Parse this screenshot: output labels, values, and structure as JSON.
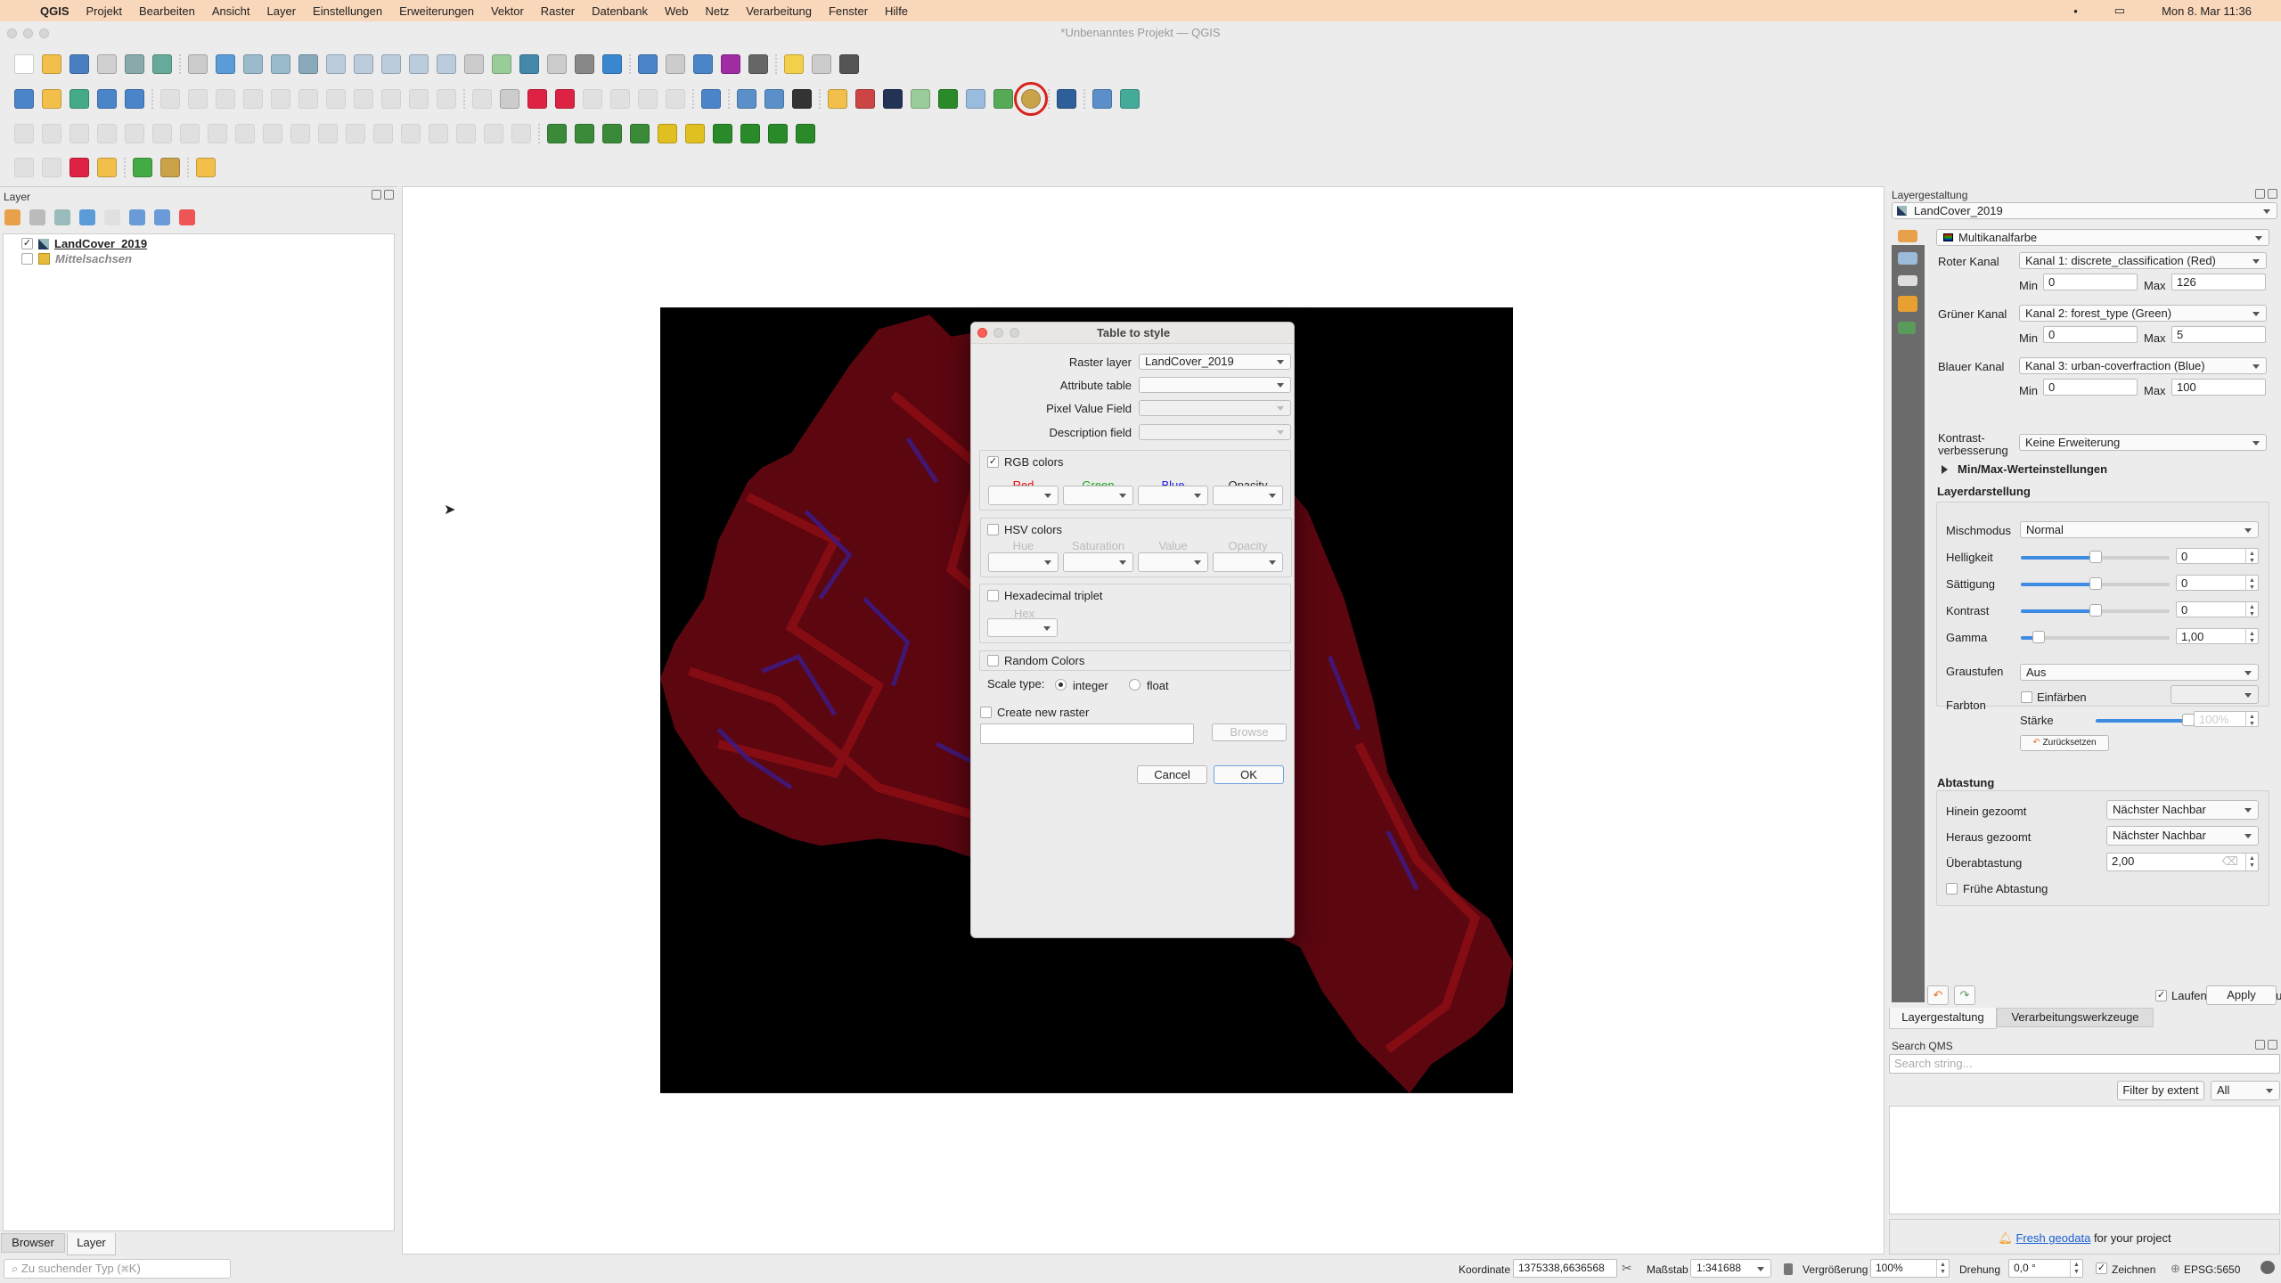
{
  "menubar": {
    "app": "QGIS",
    "items": [
      "Projekt",
      "Bearbeiten",
      "Ansicht",
      "Layer",
      "Einstellungen",
      "Erweiterungen",
      "Vektor",
      "Raster",
      "Datenbank",
      "Web",
      "Netz",
      "Verarbeitung",
      "Fenster",
      "Hilfe"
    ],
    "clock": "Mon 8. Mar  11:36"
  },
  "window": {
    "title": "*Unbenanntes Projekt — QGIS"
  },
  "toolbars": [
    [
      [
        "new-project",
        "#fff"
      ],
      [
        "open-project",
        "#f2c04a"
      ],
      [
        "save-project",
        "#4a7fc1"
      ],
      [
        "save-as",
        "#d0d0d0"
      ],
      [
        "print-layout",
        "#8aa"
      ],
      [
        "style-manager",
        "#6a9"
      ],
      [
        "|"
      ],
      [
        "pan",
        "#ccc"
      ],
      [
        "pan-to-selection",
        "#5a9bd8"
      ],
      [
        "zoom-in",
        "#9bc"
      ],
      [
        "zoom-out",
        "#9bc"
      ],
      [
        "zoom-full",
        "#8ab"
      ],
      [
        "zoom-selection",
        "#bcd"
      ],
      [
        "zoom-layer",
        "#bcd"
      ],
      [
        "zoom-native",
        "#bcd"
      ],
      [
        "zoom-last",
        "#bcd"
      ],
      [
        "zoom-next",
        "#bcd"
      ],
      [
        "new-map-view",
        "#ccc"
      ],
      [
        "new-3d-view",
        "#9c9"
      ],
      [
        "bookmark-new",
        "#48a"
      ],
      [
        "bookmarks",
        "#ccc"
      ],
      [
        "temporal",
        "#888"
      ],
      [
        "refresh",
        "#3a87d0"
      ],
      [
        "|"
      ],
      [
        "identify",
        "#4a84c9"
      ],
      [
        "attribute-table",
        "#ccc"
      ],
      [
        "settings",
        "#4a84c9"
      ],
      [
        "statistics",
        "#a02ba2"
      ],
      [
        "measure",
        "#666"
      ],
      [
        "|"
      ],
      [
        "map-tips",
        "#f2d04a"
      ],
      [
        "text-annotation",
        "#ccc"
      ],
      [
        "text-tool",
        "#555"
      ]
    ],
    [
      [
        "data-source-manager",
        "#4a84c9"
      ],
      [
        "new-geopackage",
        "#f2c04a"
      ],
      [
        "new-shapefile",
        "#4a8"
      ],
      [
        "new-temp-layer",
        "#4a84c9"
      ],
      [
        "new-virtual-layer",
        "#4a84c9"
      ],
      [
        "|"
      ],
      [
        "toggle-edit",
        "#ccc",
        1
      ],
      [
        "edit-pen",
        "#ccc",
        1
      ],
      [
        "save-edits",
        "#ccc",
        1
      ],
      [
        "add-feature",
        "#ccc",
        1
      ],
      [
        "vertex-tool",
        "#ccc",
        1
      ],
      [
        "delete",
        "#ccc",
        1
      ],
      [
        "cut",
        "#ccc",
        1
      ],
      [
        "copy",
        "#ccc",
        1
      ],
      [
        "paste",
        "#ccc",
        1
      ],
      [
        "undo",
        "#ccc",
        1
      ],
      [
        "redo",
        "#ccc",
        1
      ],
      [
        "|"
      ],
      [
        "label-tool",
        "#ccc",
        1
      ],
      [
        "label-pin",
        "#ccc"
      ],
      [
        "label-highlight",
        "#d24"
      ],
      [
        "label-abc",
        "#d24"
      ],
      [
        "label-move",
        "#ccc",
        1
      ],
      [
        "label-rotate",
        "#ccc",
        1
      ],
      [
        "label-change",
        "#ccc",
        1
      ],
      [
        "label-show",
        "#ccc",
        1
      ],
      [
        "|"
      ],
      [
        "database",
        "#4a84c9"
      ],
      [
        "|"
      ],
      [
        "globe-search",
        "#5a8fc9"
      ],
      [
        "metasearch",
        "#5a8fc9"
      ],
      [
        "qms-binoculars",
        "#333"
      ],
      [
        "|"
      ],
      [
        "python-console",
        "#f2c04a"
      ],
      [
        "plugin-fire",
        "#c44"
      ],
      [
        "earth",
        "#235"
      ],
      [
        "layers-leaf",
        "#9c9"
      ],
      [
        "info-cursor",
        "#2a8a2a"
      ],
      [
        "split-view",
        "#9bd"
      ],
      [
        "butterfly",
        "#5a5"
      ],
      [
        "table-to-style",
        "#c9a24a"
      ],
      [
        "|"
      ],
      [
        "help",
        "#2f5f9a"
      ],
      [
        "|"
      ],
      [
        "topology",
        "#5a8fc9"
      ],
      [
        "table-refresh",
        "#4a9"
      ]
    ],
    [
      [
        "digitize",
        "#ccc",
        1
      ],
      [
        "digitize-2",
        "#ccc",
        1
      ],
      [
        "digitize-3",
        "#ccc",
        1
      ],
      [
        "digitize-4",
        "#ccc",
        1
      ],
      [
        "digitize-5",
        "#ccc",
        1
      ],
      [
        "digitize-6",
        "#ccc",
        1
      ],
      [
        "digitize-7",
        "#ccc",
        1
      ],
      [
        "digitize-8",
        "#ccc",
        1
      ],
      [
        "digitize-9",
        "#ccc",
        1
      ],
      [
        "digitize-10",
        "#ccc",
        1
      ],
      [
        "digitize-11",
        "#ccc",
        1
      ],
      [
        "digitize-12",
        "#ccc",
        1
      ],
      [
        "digitize-13",
        "#ccc",
        1
      ],
      [
        "digitize-14",
        "#ccc",
        1
      ],
      [
        "digitize-15",
        "#ccc",
        1
      ],
      [
        "digitize-16",
        "#ccc",
        1
      ],
      [
        "digitize-17",
        "#ccc",
        1
      ],
      [
        "digitize-18",
        "#ccc",
        1
      ],
      [
        "digitize-19",
        "#ccc",
        1
      ],
      [
        "|"
      ],
      [
        "raster-hist-1",
        "#3a8a3a"
      ],
      [
        "raster-hist-2",
        "#3a8a3a"
      ],
      [
        "raster-hist-3",
        "#3a8a3a"
      ],
      [
        "raster-hist-4",
        "#3a8a3a"
      ],
      [
        "add-star-1",
        "#e0c020"
      ],
      [
        "add-star-2",
        "#e0c020"
      ],
      [
        "add-point-1",
        "#2a8a2a"
      ],
      [
        "add-point-2",
        "#2a8a2a"
      ],
      [
        "add-v-1",
        "#2a8a2a"
      ],
      [
        "add-v-2",
        "#2a8a2a"
      ]
    ],
    [
      [
        "select-1",
        "#ccc",
        1
      ],
      [
        "select-2",
        "#ccc",
        1
      ],
      [
        "select-expr",
        "#d24"
      ],
      [
        "select-yellow",
        "#f2c04a"
      ],
      [
        "|"
      ],
      [
        "locator",
        "#4a4"
      ],
      [
        "field-calc",
        "#c9a24a"
      ],
      [
        "|"
      ],
      [
        "vector-tool",
        "#f2c04a"
      ]
    ]
  ],
  "layers_panel": {
    "title": "Layer",
    "items": [
      {
        "name": "LandCover_2019",
        "checked": true
      },
      {
        "name": "Mittelsachsen",
        "checked": false
      }
    ],
    "tabs": [
      "Browser",
      "Layer"
    ],
    "search_placeholder": "Zu suchender Typ (⌘K)"
  },
  "dialog": {
    "title": "Table to style",
    "raster_layer_label": "Raster layer",
    "raster_layer_value": "LandCover_2019",
    "attribute_table_label": "Attribute table",
    "pixel_value_label": "Pixel Value Field",
    "description_label": "Description field",
    "rgb": {
      "label": "RGB colors",
      "checked": true,
      "cols": [
        "Red",
        "Green",
        "Blue",
        "Opacity"
      ],
      "colors": [
        "#e8000b",
        "#1aa31a",
        "#1414e6",
        "#222222"
      ]
    },
    "hsv": {
      "label": "HSV colors",
      "checked": false,
      "cols": [
        "Hue",
        "Saturation",
        "Value",
        "Opacity"
      ]
    },
    "hex": {
      "label": "Hexadecimal triplet",
      "checked": false,
      "col": "Hex"
    },
    "random": {
      "label": "Random Colors",
      "checked": false
    },
    "scale_type_label": "Scale type:",
    "scale_options": [
      "integer",
      "float"
    ],
    "scale_selected": "integer",
    "create_raster_label": "Create new raster",
    "browse": "Browse",
    "cancel": "Cancel",
    "ok": "OK"
  },
  "style_panel": {
    "title": "Layergestaltung",
    "layer": "LandCover_2019",
    "renderer": "Multikanalfarbe",
    "channels": [
      {
        "label": "Roter Kanal",
        "band": "Kanal 1: discrete_classification (Red)",
        "min": "0",
        "max": "126"
      },
      {
        "label": "Grüner Kanal",
        "band": "Kanal 2: forest_type (Green)",
        "min": "0",
        "max": "5"
      },
      {
        "label": "Blauer Kanal",
        "band": "Kanal 3: urban-coverfraction (Blue)",
        "min": "0",
        "max": "100"
      }
    ],
    "min_label": "Min",
    "max_label": "Max",
    "contrast_label_1": "Kontrast-",
    "contrast_label_2": "verbesserung",
    "contrast_value": "Keine Erweiterung",
    "minmax_section": "Min/Max-Werteinstellungen",
    "rendering_section": "Layerdarstellung",
    "blend_label": "Mischmodus",
    "blend_value": "Normal",
    "sliders": [
      {
        "label": "Helligkeit",
        "value": "0",
        "fraction": 0.5
      },
      {
        "label": "Sättigung",
        "value": "0",
        "fraction": 0.5
      },
      {
        "label": "Kontrast",
        "value": "0",
        "fraction": 0.5
      },
      {
        "label": "Gamma",
        "value": "1,00",
        "fraction": 0.12
      }
    ],
    "grayscale_label": "Graustufen",
    "grayscale_value": "Aus",
    "hue_label": "Farbton",
    "colorize_label": "Einfärben",
    "strength_label": "Stärke",
    "strength_value": "100%",
    "strength_fraction": 1.0,
    "reset": "Zurücksetzen",
    "resampling_section": "Abtastung",
    "zoomed_in_label": "Hinein gezoomt",
    "zoomed_in_value": "Nächster Nachbar",
    "zoomed_out_label": "Heraus gezoomt",
    "zoomed_out_value": "Nächster Nachbar",
    "oversampling_label": "Überabtastung",
    "oversampling_value": "2,00",
    "early_resampling_label": "Frühe Abtastung",
    "live_update_label": "Laufende Aktualisierung",
    "apply": "Apply",
    "tabs": [
      "Layergestaltung",
      "Verarbeitungswerkzeuge"
    ]
  },
  "qms_panel": {
    "title": "Search QMS",
    "search_placeholder": "Search string...",
    "filter_button": "Filter by extent",
    "filter_value": "All",
    "fresh_link": "Fresh geodata",
    "fresh_text": "for your project"
  },
  "statusbar": {
    "coordinate_label": "Koordinate",
    "coordinate_value": "1375338,6636568",
    "scale_label": "Maßstab",
    "scale_value": "1:341688",
    "magnifier_label": "Vergrößerung",
    "magnifier_value": "100%",
    "rotation_label": "Drehung",
    "rotation_value": "0,0 °",
    "render_label": "Zeichnen",
    "crs": "EPSG:5650"
  }
}
